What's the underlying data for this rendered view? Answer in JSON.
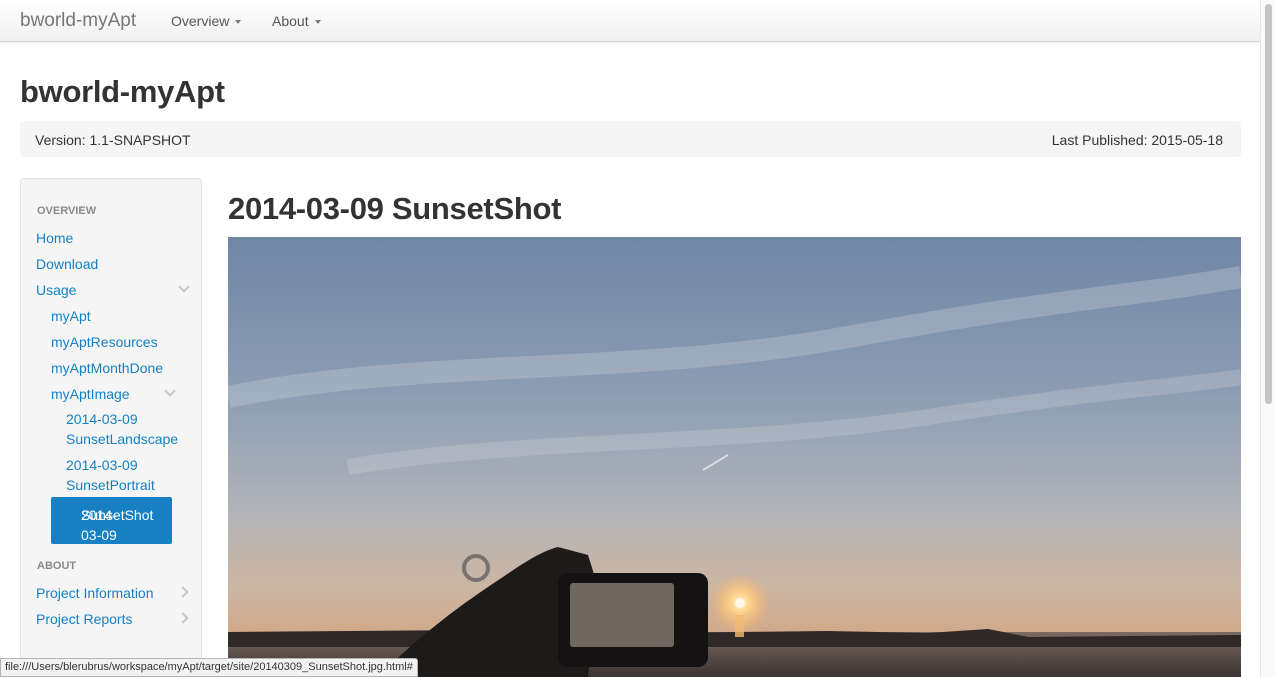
{
  "navbar": {
    "brand": "bworld-myApt",
    "menus": [
      {
        "label": "Overview"
      },
      {
        "label": "About"
      }
    ]
  },
  "header": {
    "title": "bworld-myApt",
    "version": "Version: 1.1-SNAPSHOT",
    "published": "Last Published: 2015-05-18"
  },
  "sidebar": {
    "overview_header": "OVERVIEW",
    "home": "Home",
    "download": "Download",
    "usage": "Usage",
    "myapt": "myApt",
    "myapt_resources": "myAptResources",
    "myapt_month_done": "myAptMonthDone",
    "myapt_image": "myAptImage",
    "sunset_landscape": [
      "2014-03-09",
      "SunsetLandscape"
    ],
    "sunset_portrait": [
      "2014-03-09",
      "SunsetPortrait"
    ],
    "sunset_shot": [
      "2014-03-09",
      "SunsetShot"
    ],
    "about_header": "ABOUT",
    "project_information": "Project Information",
    "project_reports": "Project Reports"
  },
  "content": {
    "heading": "2014-03-09 SunsetShot",
    "image_alt": "Sunset photo: a hand holding a phone photographing the sun setting over water"
  },
  "status_bar": {
    "url": "file:///Users/blerubrus/workspace/myApt/target/site/20140309_SunsetShot.jpg.html#"
  },
  "colors": {
    "link": "#1780c2",
    "active_bg": "#1780c2",
    "well_bg": "#f5f5f5"
  }
}
